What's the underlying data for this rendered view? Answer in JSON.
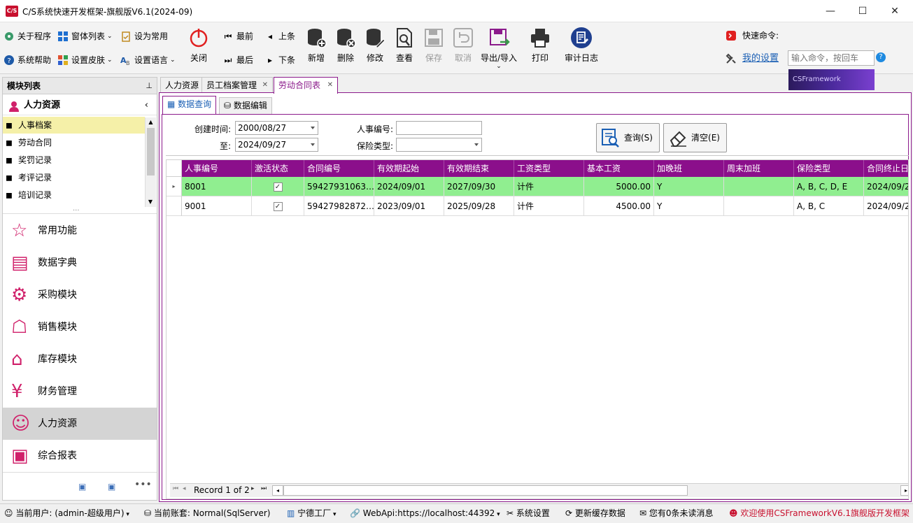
{
  "window": {
    "title": "C/S系统快速开发框架-旗舰版V6.1(2024-09)",
    "logo_text": "C/S",
    "min_glyph": "—",
    "max_glyph": "☐",
    "close_glyph": "✕"
  },
  "ribbon": {
    "about": "关于程序",
    "window_list": "窗体列表",
    "set_common": "设为常用",
    "help": "系统帮助",
    "skin": "设置皮肤",
    "language": "设置语言",
    "close": "关闭",
    "first": "最前",
    "prev": "上条",
    "last": "最后",
    "next": "下条",
    "add": "新增",
    "delete": "删除",
    "edit": "修改",
    "view": "查看",
    "save": "保存",
    "cancel": "取消",
    "export_import": "导出/导入",
    "print": "打印",
    "audit_log": "审计日志",
    "quick_cmd_label": "快速命令:",
    "quick_cmd_placeholder": "输入命令，按回车",
    "my_settings": "我的设置",
    "brand": "CSFramework"
  },
  "left_panel": {
    "header": "模块列表",
    "pin": "ᵖ",
    "group": "人力资源",
    "tree_items": [
      "人事档案",
      "劳动合同",
      "奖罚记录",
      "考评记录",
      "培训记录"
    ],
    "more": "...",
    "nav_items": [
      "常用功能",
      "数据字典",
      "采购模块",
      "销售模块",
      "库存模块",
      "财务管理",
      "人力资源",
      "综合报表"
    ]
  },
  "doc_tabs": [
    "人力资源",
    "员工档案管理",
    "劳动合同表"
  ],
  "sub_tabs": [
    "数据查询",
    "数据编辑"
  ],
  "query": {
    "created_label": "创建时间:",
    "created_from": "2000/08/27",
    "to_label": "至:",
    "created_to": "2024/09/27",
    "emp_no_label": "人事编号:",
    "emp_no_value": "",
    "insurance_label": "保险类型:",
    "insurance_value": "",
    "search_btn": "查询(S)",
    "clear_btn": "清空(E)"
  },
  "grid": {
    "columns": [
      "人事编号",
      "激活状态",
      "合同编号",
      "有效期起始",
      "有效期结束",
      "工资类型",
      "基本工资",
      "加晚班",
      "周末加班",
      "保险类型",
      "合同终止日"
    ],
    "rows": [
      {
        "emp_no": "8001",
        "active": "✓",
        "contract_no": "59427931063…",
        "start": "2024/09/01",
        "end": "2027/09/30",
        "wage_type": "计件",
        "base_salary": "5000.00",
        "overtime": "Y",
        "weekend": "",
        "insurance": "A, B, C, D, E",
        "terminate": "2024/09/2"
      },
      {
        "emp_no": "9001",
        "active": "✓",
        "contract_no": "59427982872…",
        "start": "2023/09/01",
        "end": "2025/09/28",
        "wage_type": "计件",
        "base_salary": "4500.00",
        "overtime": "Y",
        "weekend": "",
        "insurance": "A, B, C",
        "terminate": "2024/09/2"
      }
    ],
    "record_text": "Record 1 of 2"
  },
  "status": {
    "user": "当前用户: (admin-超级用户)",
    "account": "当前账套: Normal(SqlServer)",
    "factory": "宁德工厂",
    "webapi": "WebApi:https://localhost:44392",
    "sys_settings": "系统设置",
    "refresh_cache": "更新缓存数据",
    "messages": "您有0条未读消息",
    "welcome": "欢迎使用CSFrameworkV6.1旗舰版开发框架"
  },
  "colors": {
    "accent": "#8b0f8b",
    "selected_row": "#90ee90",
    "tree_selected": "#f5f0a8",
    "nav_selected": "#d4d4d4"
  }
}
